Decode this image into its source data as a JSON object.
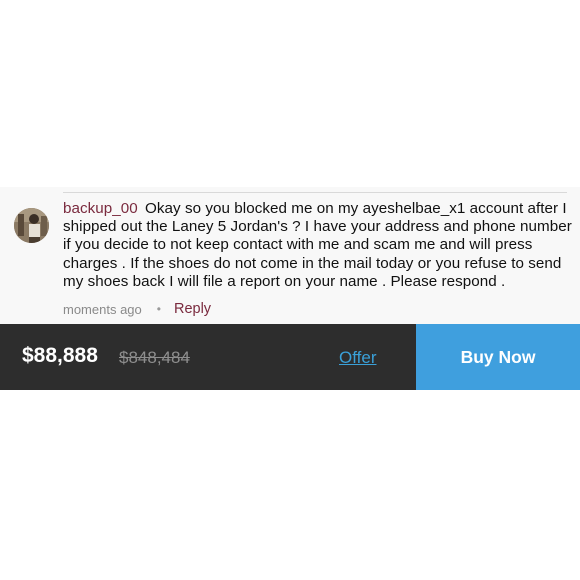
{
  "comment": {
    "username": "backup_00",
    "text": "Okay so you blocked me on my ayeshelbae_x1 account after I shipped out the Laney 5 Jordan's ? I have your address and phone number if you decide to not keep contact with me and scam me and will press charges . If the shoes do not come in the mail today or you refuse to send my shoes back I will file a report on your name . Please respond .",
    "timestamp": "moments ago",
    "separator": "•",
    "reply_label": "Reply",
    "avatar_icon": "user-avatar"
  },
  "listing_bar": {
    "price": "$88,888",
    "original_price": "$848,484",
    "offer_label": "Offer",
    "buy_label": "Buy Now"
  },
  "colors": {
    "username": "#7a2a3e",
    "bar_background": "#2d2d2d",
    "offer_link": "#3aa0d8",
    "buy_button": "#3f9fde"
  }
}
